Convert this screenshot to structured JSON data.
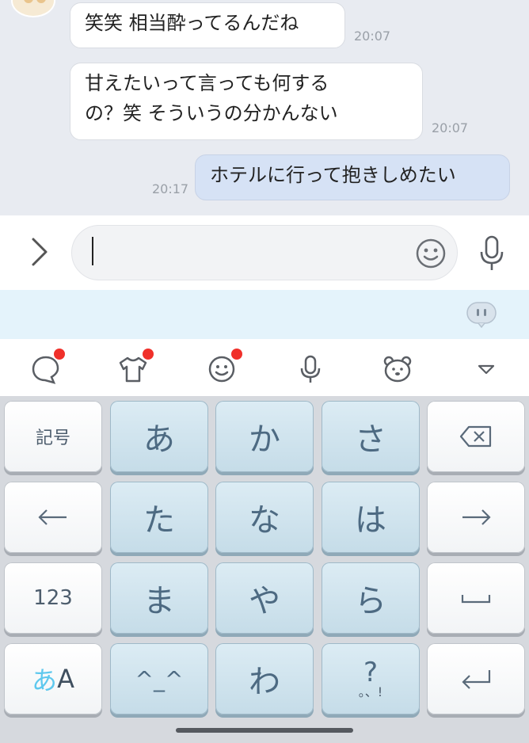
{
  "chat": {
    "messages": [
      {
        "text_lines": [
          "笑笑 相当酔ってるんだね"
        ],
        "time": "20:07",
        "mine": false
      },
      {
        "text_lines": [
          "甘えたいって言っても何する",
          "の？笑 そういうの分かんない"
        ],
        "time": "20:07",
        "mine": false
      },
      {
        "text_lines": [
          "ホテルに行って抱きしめたい"
        ],
        "time": "20:17",
        "mine": true
      }
    ]
  },
  "input": {
    "value": "",
    "placeholder": ""
  },
  "toolbar": {
    "icons": [
      "chat-bubble-icon",
      "shirt-icon",
      "emoji-icon",
      "microphone-icon",
      "bear-icon",
      "collapse-icon"
    ],
    "badge_color": "#f0302a"
  },
  "keyboard": {
    "row1": [
      "記号",
      "あ",
      "か",
      "さ",
      "⌫"
    ],
    "row2": [
      "←",
      "た",
      "な",
      "は",
      "→"
    ],
    "row3": [
      "123",
      "ま",
      "や",
      "ら",
      "␣"
    ],
    "row4_a": "あ",
    "row4_A": "A",
    "row4": [
      "^_^",
      "わ",
      "?",
      "。、!",
      "↵"
    ]
  },
  "colors": {
    "accent": "#5ec8ee",
    "key_text": "#4d6a82"
  }
}
